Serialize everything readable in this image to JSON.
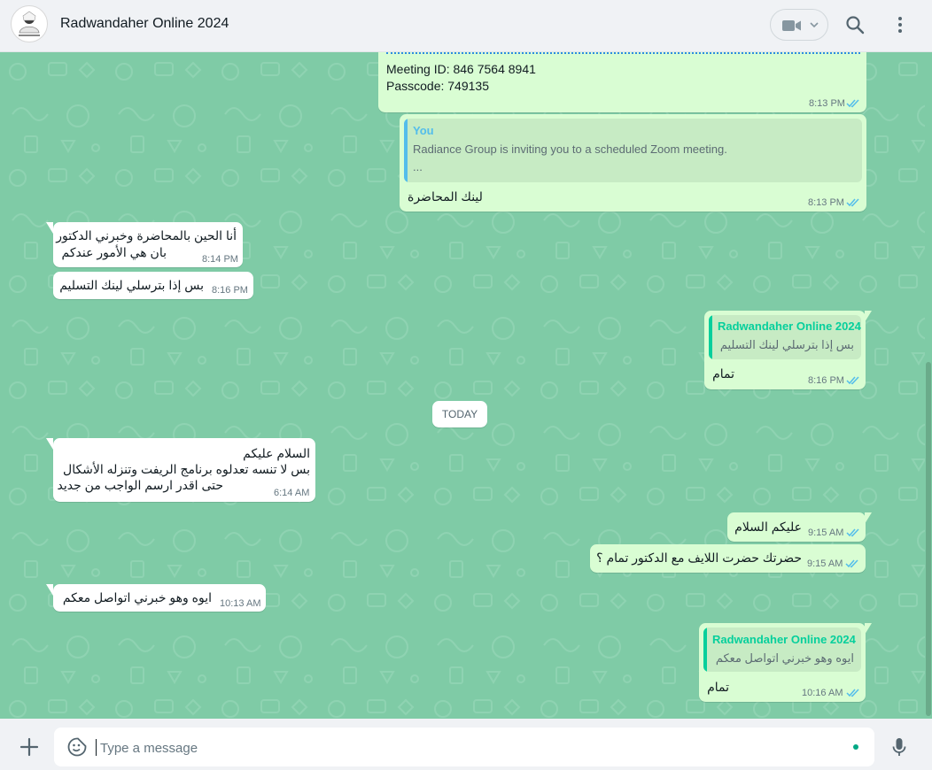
{
  "header": {
    "title": "Radwandaher Online 2024",
    "icons": {
      "video": "video-call-icon",
      "dropdown": "chevron-down-icon",
      "search": "search-icon",
      "menu": "more-vert-icon"
    }
  },
  "colors": {
    "chat_bg": "#7fcba6",
    "incoming": "#ffffff",
    "outgoing": "#d9fdd3",
    "read_tick": "#53bdeb",
    "quote_you": "#53bdeb",
    "quote_contact": "#06cf9c"
  },
  "messages": [
    {
      "dir": "out",
      "lines": [
        "Meeting ID: 846 7564 8941",
        "Passcode: 749135"
      ],
      "time": "8:13 PM",
      "status": "read"
    },
    {
      "dir": "out",
      "quote": {
        "name": "You",
        "lines": [
          "Radiance Group is inviting you to a scheduled Zoom meeting.",
          "..."
        ]
      },
      "lines": [
        "لينك المحاضرة"
      ],
      "time": "8:13 PM",
      "status": "read"
    },
    {
      "dir": "in",
      "lines": [
        "أنا الحين بالمحاضرة وخبرني الدكتور",
        "بان هي الأمور عندكم"
      ],
      "time": "8:14 PM"
    },
    {
      "dir": "in",
      "lines": [
        "بس إذا بترسلي لينك التسليم"
      ],
      "time": "8:16 PM"
    },
    {
      "dir": "out",
      "quote": {
        "name": "Radwandaher Online 2024",
        "lines": [
          "بس إذا بترسلي لينك التسليم"
        ]
      },
      "lines": [
        "تمام"
      ],
      "time": "8:16 PM",
      "status": "read"
    },
    {
      "dir": "in",
      "lines": [
        "السلام عليكم",
        "بس لا تنسه تعدلوه برنامج الريفت وتنزله الأشكال",
        "حتى اقدر ارسم الواجب من جديد"
      ],
      "time": "6:14 AM"
    },
    {
      "dir": "out",
      "lines": [
        "عليكم السلام"
      ],
      "time": "9:15 AM",
      "status": "read"
    },
    {
      "dir": "out",
      "lines": [
        "حضرتك حضرت اللايف مع الدكتور تمام ؟"
      ],
      "time": "9:15 AM",
      "status": "read"
    },
    {
      "dir": "in",
      "lines": [
        "ايوه وهو خبرني اتواصل معكم"
      ],
      "time": "10:13 AM"
    },
    {
      "dir": "out",
      "quote": {
        "name": "Radwandaher Online 2024",
        "lines": [
          "ايوه وهو خبرني اتواصل معكم"
        ]
      },
      "lines": [
        "تمام"
      ],
      "time": "10:16 AM",
      "status": "read"
    }
  ],
  "date_chip": "TODAY",
  "composer": {
    "placeholder": "Type a message",
    "icons": {
      "attach": "plus-icon",
      "emoji": "sticker-emoji-icon",
      "mic": "microphone-icon"
    }
  }
}
